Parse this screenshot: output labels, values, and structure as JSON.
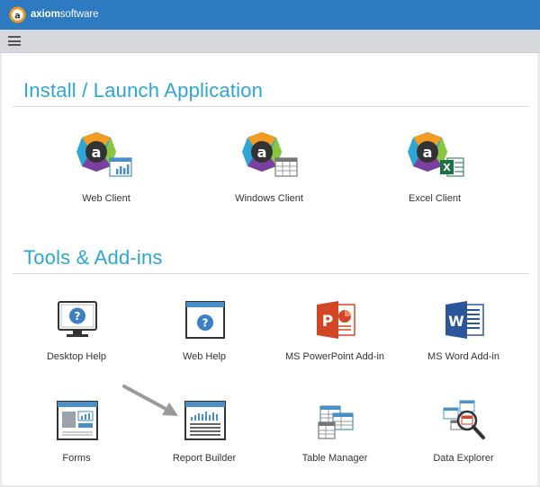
{
  "app": {
    "brand_bold": "axiom",
    "brand_light": "software"
  },
  "sections": {
    "install": {
      "title": "Install / Launch Application",
      "items": [
        {
          "label": "Web Client"
        },
        {
          "label": "Windows Client"
        },
        {
          "label": "Excel Client"
        }
      ]
    },
    "tools": {
      "title": "Tools & Add-ins",
      "items": [
        {
          "label": "Desktop Help"
        },
        {
          "label": "Web Help"
        },
        {
          "label": "MS PowerPoint Add-in"
        },
        {
          "label": "MS Word Add-in"
        },
        {
          "label": "Forms"
        },
        {
          "label": "Report Builder"
        },
        {
          "label": "Table Manager"
        },
        {
          "label": "Data Explorer"
        }
      ]
    }
  },
  "colors": {
    "topbar": "#2d7ac0",
    "section_title": "#2ea6d3",
    "powerpoint": "#d24625",
    "word": "#2b579a",
    "excel": "#1e7145"
  }
}
